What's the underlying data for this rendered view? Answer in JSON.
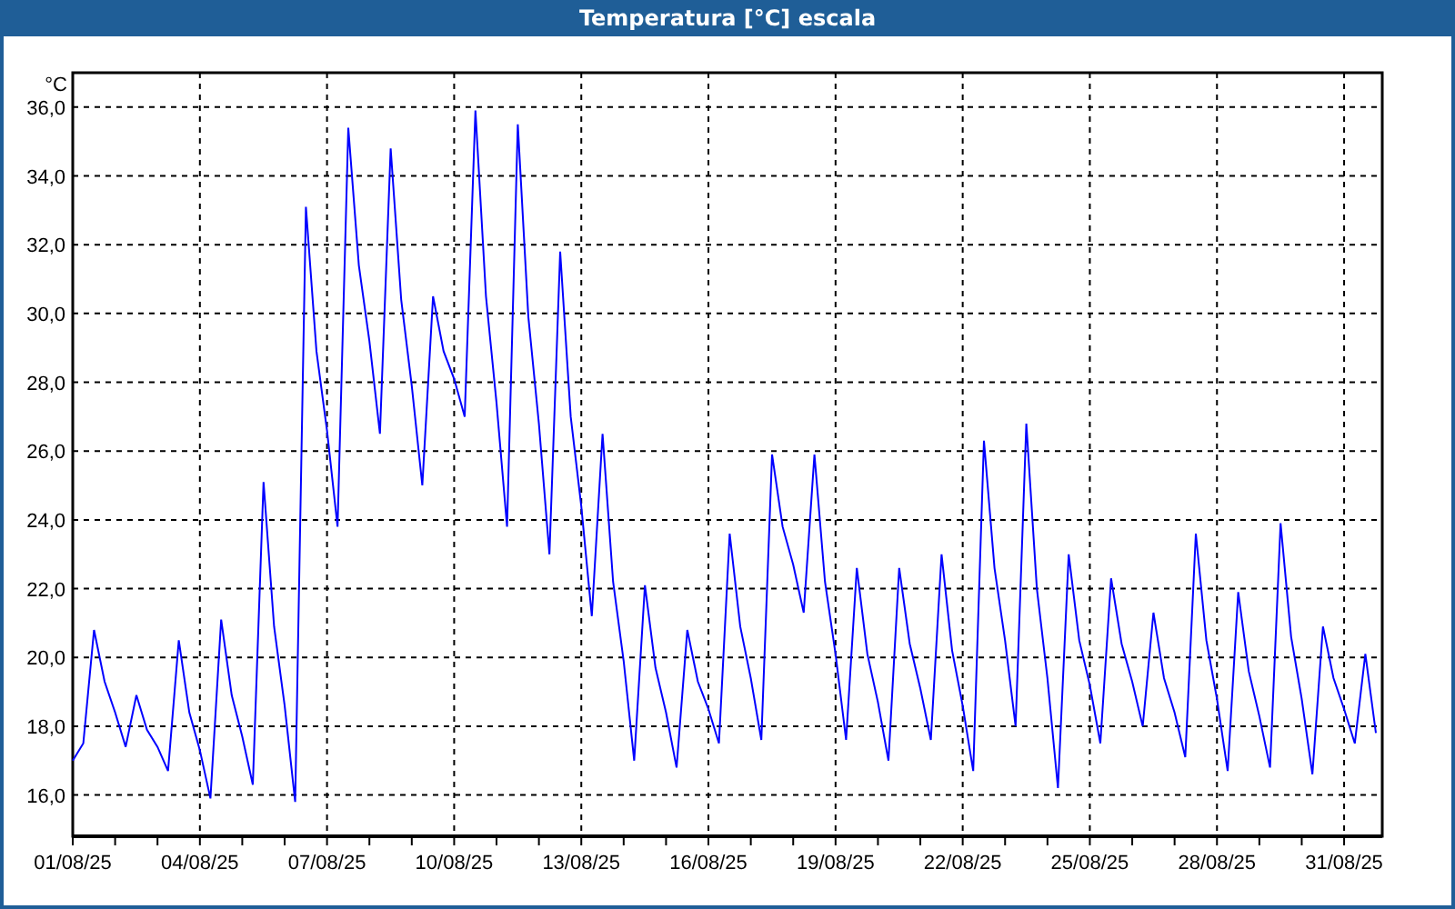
{
  "window": {
    "title": "Temperatura [°C] escala"
  },
  "chart": {
    "chart_data": {
      "type": "line",
      "ylabel": "°C",
      "categories": [
        "01/08/25",
        null,
        null,
        null,
        null,
        null,
        null,
        null,
        null,
        null,
        null,
        null,
        "04/08/25",
        null,
        null,
        null,
        null,
        null,
        null,
        null,
        null,
        null,
        null,
        null,
        "07/08/25",
        null,
        null,
        null,
        null,
        null,
        null,
        null,
        null,
        null,
        null,
        null,
        "10/08/25",
        null,
        null,
        null,
        null,
        null,
        null,
        null,
        null,
        null,
        null,
        null,
        "13/08/25",
        null,
        null,
        null,
        null,
        null,
        null,
        null,
        null,
        null,
        null,
        null,
        "16/08/25",
        null,
        null,
        null,
        null,
        null,
        null,
        null,
        null,
        null,
        null,
        null,
        "19/08/25",
        null,
        null,
        null,
        null,
        null,
        null,
        null,
        null,
        null,
        null,
        null,
        "22/08/25",
        null,
        null,
        null,
        null,
        null,
        null,
        null,
        null,
        null,
        null,
        null,
        "25/08/25",
        null,
        null,
        null,
        null,
        null,
        null,
        null,
        null,
        null,
        null,
        null,
        "28/08/25",
        null,
        null,
        null,
        null,
        null,
        null,
        null,
        null,
        null,
        null,
        null,
        "31/08/25",
        null,
        null,
        null
      ],
      "series": [
        {
          "color": "#0000ff",
          "values": [
            17.0,
            17.5,
            20.8,
            19.3,
            18.4,
            17.4,
            18.9,
            17.9,
            17.4,
            16.7,
            20.5,
            18.4,
            17.3,
            15.9,
            21.1,
            18.9,
            17.7,
            16.3,
            25.1,
            20.9,
            18.6,
            15.8,
            33.1,
            28.9,
            26.6,
            23.8,
            35.4,
            31.4,
            29.2,
            26.5,
            34.8,
            30.4,
            27.9,
            25.0,
            30.5,
            28.9,
            28.1,
            27.0,
            35.9,
            30.5,
            27.4,
            23.8,
            35.5,
            29.9,
            26.8,
            23.0,
            31.8,
            27.0,
            24.4,
            21.2,
            26.5,
            22.2,
            19.9,
            17.0,
            22.1,
            19.7,
            18.4,
            16.8,
            20.8,
            19.3,
            18.5,
            17.5,
            23.6,
            20.9,
            19.4,
            17.6,
            25.9,
            23.8,
            22.7,
            21.3,
            25.9,
            22.2,
            20.1,
            17.6,
            22.6,
            20.1,
            18.7,
            17.0,
            22.6,
            20.4,
            19.1,
            17.6,
            23.0,
            20.2,
            18.6,
            16.7,
            26.3,
            22.6,
            20.5,
            18.0,
            26.8,
            22.0,
            19.4,
            16.2,
            23.0,
            20.5,
            19.2,
            17.5,
            22.3,
            20.4,
            19.3,
            18.0,
            21.3,
            19.4,
            18.4,
            17.1,
            23.6,
            20.5,
            18.8,
            16.7,
            21.9,
            19.6,
            18.3,
            16.8,
            23.9,
            20.6,
            18.8,
            16.6,
            20.9,
            19.4,
            18.5,
            17.5,
            20.1,
            17.8
          ]
        }
      ],
      "grid": true,
      "ylim": [
        14.8,
        37.0
      ],
      "yticks": [
        {
          "value": 16,
          "label": "16,0"
        },
        {
          "value": 18,
          "label": "18,0"
        },
        {
          "value": 20,
          "label": "20,0"
        },
        {
          "value": 22,
          "label": "22,0"
        },
        {
          "value": 24,
          "label": "24,0"
        },
        {
          "value": 26,
          "label": "26,0"
        },
        {
          "value": 28,
          "label": "28,0"
        },
        {
          "value": 30,
          "label": "30,0"
        },
        {
          "value": 32,
          "label": "32,0"
        },
        {
          "value": 34,
          "label": "34,0"
        },
        {
          "value": 36,
          "label": "36,0"
        }
      ]
    }
  }
}
